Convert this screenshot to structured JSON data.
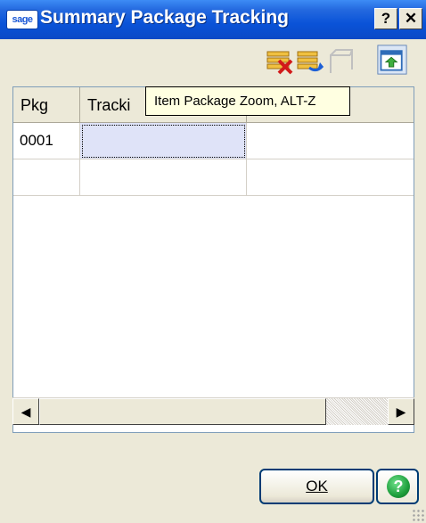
{
  "window": {
    "logo_text": "sage",
    "title": "Summary Package Tracking",
    "help_button": "?",
    "close_button": "✕"
  },
  "toolbar": {
    "tooltip": "Item Package Zoom, ALT-Z",
    "icons": [
      "delete-rows-icon",
      "refresh-icon",
      "frame-icon",
      "item-package-zoom-icon"
    ]
  },
  "grid": {
    "columns": [
      "Pkg",
      "Tracki"
    ],
    "rows": [
      {
        "pkg": "0001",
        "tracking": ""
      }
    ]
  },
  "scrollbar": {
    "left_arrow": "◀",
    "right_arrow": "▶"
  },
  "buttons": {
    "ok": "OK",
    "help": "?"
  }
}
